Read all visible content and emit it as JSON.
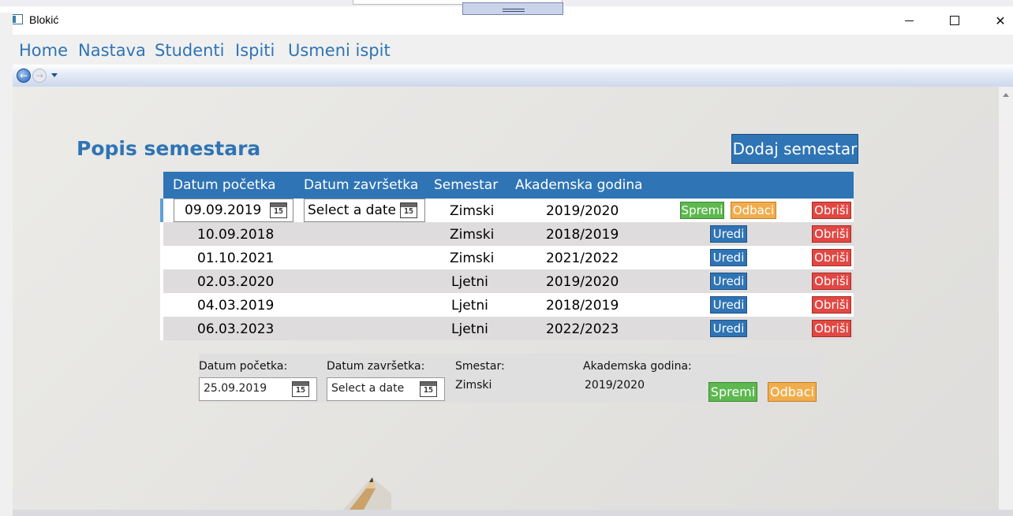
{
  "window": {
    "title": "Blokić"
  },
  "nav": {
    "items": [
      "Home",
      "Nastava",
      "Studenti",
      "Ispiti",
      "Usmeni ispit"
    ]
  },
  "page": {
    "title": "Popis semestara",
    "add_button": "Dodaj semestar"
  },
  "table": {
    "columns": [
      "Datum početka",
      "Datum završetka",
      "Semestar",
      "Akademska godina"
    ],
    "edit_row": {
      "start_date": "09.09.2019",
      "end_date_placeholder": "Select a date",
      "semestar": "Zimski",
      "akademska_godina": "2019/2020",
      "save_label": "Spremi",
      "cancel_label": "Odbaci",
      "delete_label": "Obriši"
    },
    "rows": [
      {
        "start": "10.09.2018",
        "end": "",
        "semestar": "Zimski",
        "godina": "2018/2019"
      },
      {
        "start": "01.10.2021",
        "end": "",
        "semestar": "Zimski",
        "godina": "2021/2022"
      },
      {
        "start": "02.03.2020",
        "end": "",
        "semestar": "Ljetni",
        "godina": "2019/2020"
      },
      {
        "start": "04.03.2019",
        "end": "",
        "semestar": "Ljetni",
        "godina": "2018/2019"
      },
      {
        "start": "06.03.2023",
        "end": "",
        "semestar": "Ljetni",
        "godina": "2022/2023"
      }
    ],
    "edit_label": "Uredi",
    "delete_label": "Obriši"
  },
  "form": {
    "start_label": "Datum početka:",
    "start_value": "25.09.2019",
    "end_label": "Datum završetka:",
    "end_placeholder": "Select a date",
    "semestar_label": "Smestar:",
    "semestar_value": "Zimski",
    "godina_label": "Akademska godina:",
    "godina_value": "2019/2020",
    "save_label": "Spremi",
    "cancel_label": "Odbaci"
  },
  "calendar_day": "15",
  "colors": {
    "accent": "#2f74b5",
    "success": "#5cb84f",
    "warning": "#f0ad4e",
    "danger": "#e24843"
  }
}
